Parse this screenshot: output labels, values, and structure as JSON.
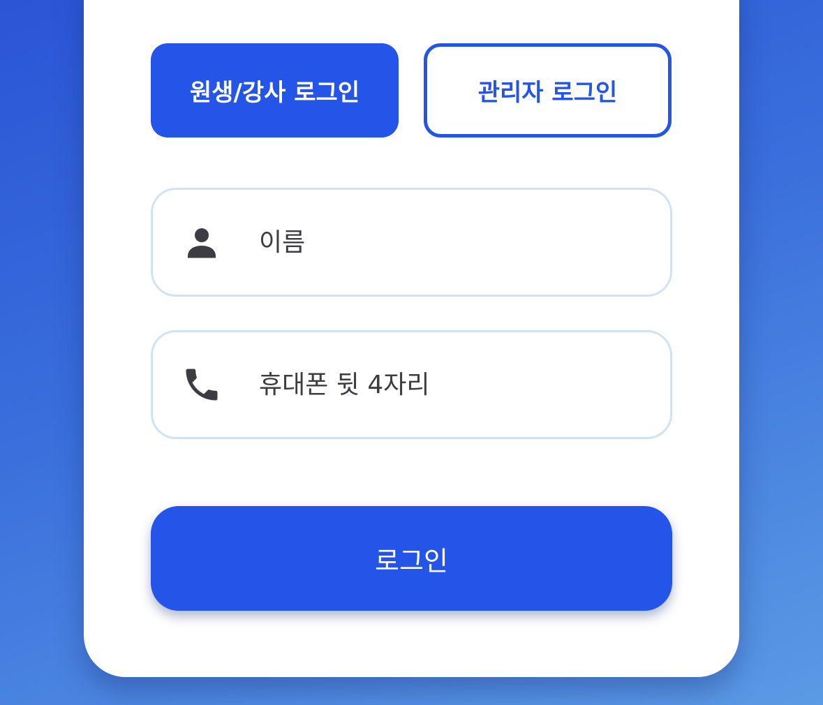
{
  "tabs": {
    "student_label": "원생/강사 로그인",
    "admin_label": "관리자 로그인"
  },
  "form": {
    "name_placeholder": "이름",
    "name_icon": "person-icon",
    "phone_placeholder": "휴대폰 뒷 4자리",
    "phone_icon": "phone-icon",
    "submit_label": "로그인"
  },
  "colors": {
    "accent": "#2454e8",
    "field_border": "#cfe3f2",
    "text": "#3c3c42"
  }
}
